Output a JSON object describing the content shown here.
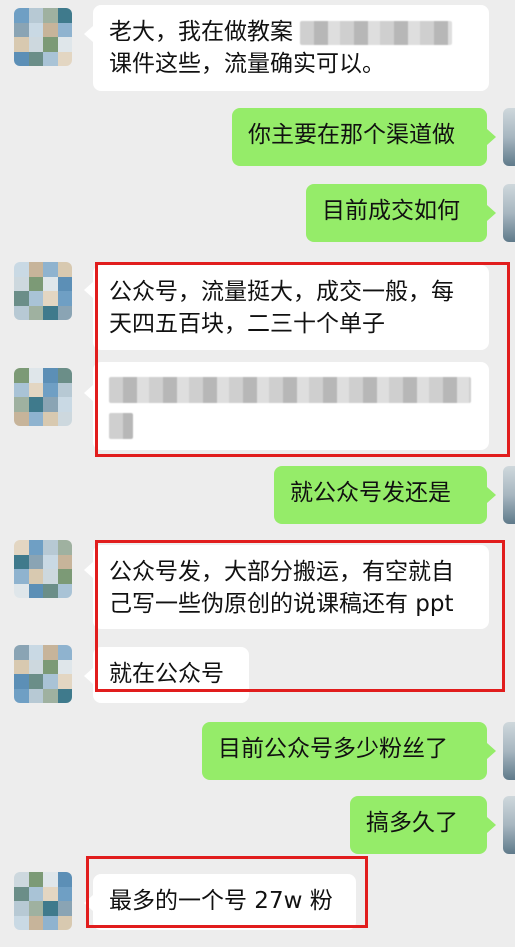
{
  "chat": {
    "messages": [
      {
        "side": "in",
        "line1": "老大，我在做教案",
        "line2": "课件这些，流量确实可以。"
      },
      {
        "side": "out",
        "text": "你主要在那个渠道做"
      },
      {
        "side": "out",
        "text": "目前成交如何"
      },
      {
        "side": "in",
        "line1": "公众号，流量挺大，成交一般，每",
        "line2": "天四五百块，二三十个单子"
      },
      {
        "side": "in",
        "redacted": true
      },
      {
        "side": "out",
        "text": "就公众号发还是"
      },
      {
        "side": "in",
        "line1": "公众号发，大部分搬运，有空就自",
        "line2": "己写一些伪原创的说课稿还有 ppt"
      },
      {
        "side": "in",
        "text": "就在公众号"
      },
      {
        "side": "out",
        "text": "目前公众号多少粉丝了"
      },
      {
        "side": "out",
        "text": "搞多久了"
      },
      {
        "side": "in",
        "text": "最多的一个号 27w 粉"
      }
    ]
  },
  "colors": {
    "background": "#ededed",
    "incoming_bubble": "#ffffff",
    "outgoing_bubble": "#95ec69",
    "highlight_box": "#e11d1d"
  }
}
